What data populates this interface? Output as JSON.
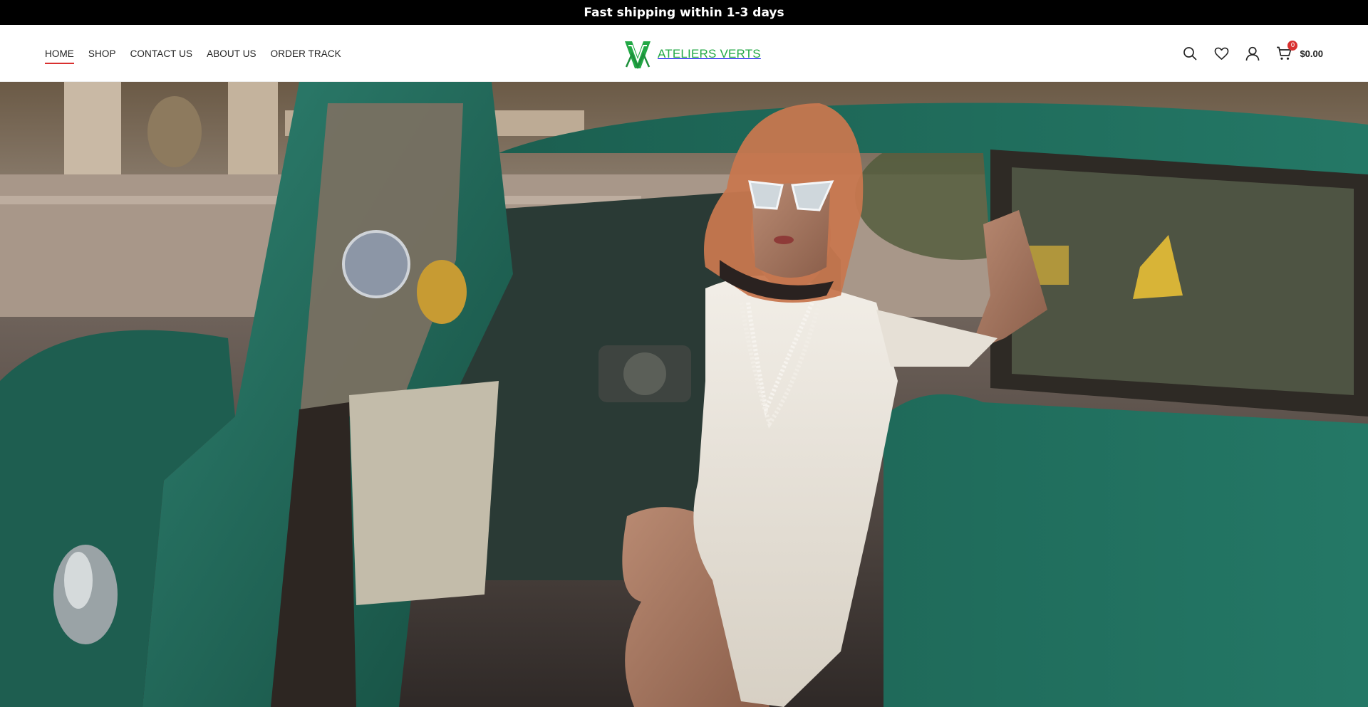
{
  "announcement": {
    "text": "Fast shipping within 1-3 days"
  },
  "nav": {
    "items": [
      {
        "label": "HOME",
        "active": true
      },
      {
        "label": "SHOP",
        "active": false
      },
      {
        "label": "CONTACT US",
        "active": false
      },
      {
        "label": "ABOUT US",
        "active": false
      },
      {
        "label": "ORDER TRACK",
        "active": false
      }
    ]
  },
  "brand": {
    "name": "ATELIERS VERTS",
    "color": "#22a845"
  },
  "header_tools": {
    "cart_count": "0",
    "cart_total": "$0.00",
    "icons": [
      "search-icon",
      "heart-icon",
      "user-icon",
      "cart-icon"
    ]
  },
  "hero": {
    "image_description_icon": "hero-photo",
    "palette": {
      "car": "#1f6b5a",
      "dress": "#ece7df",
      "scarf": "#c7774f"
    }
  },
  "colors": {
    "accent": "#d9302f",
    "announcement_bg": "#000000"
  }
}
